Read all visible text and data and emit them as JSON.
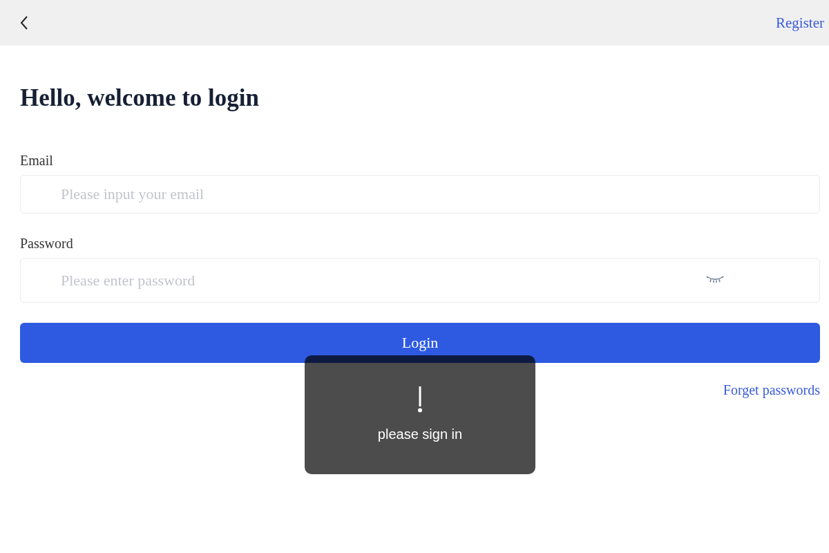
{
  "header": {
    "register_link": "Register"
  },
  "title": "Hello, welcome to login",
  "fields": [
    {
      "kind": "text",
      "label": "Email",
      "placeholder": "Please input your email"
    },
    {
      "kind": "password",
      "label": "Password",
      "placeholder": "Please enter password"
    }
  ],
  "login_button": "Login",
  "forgot_link": "Forget passwords",
  "toast": {
    "message": "please sign in"
  }
}
